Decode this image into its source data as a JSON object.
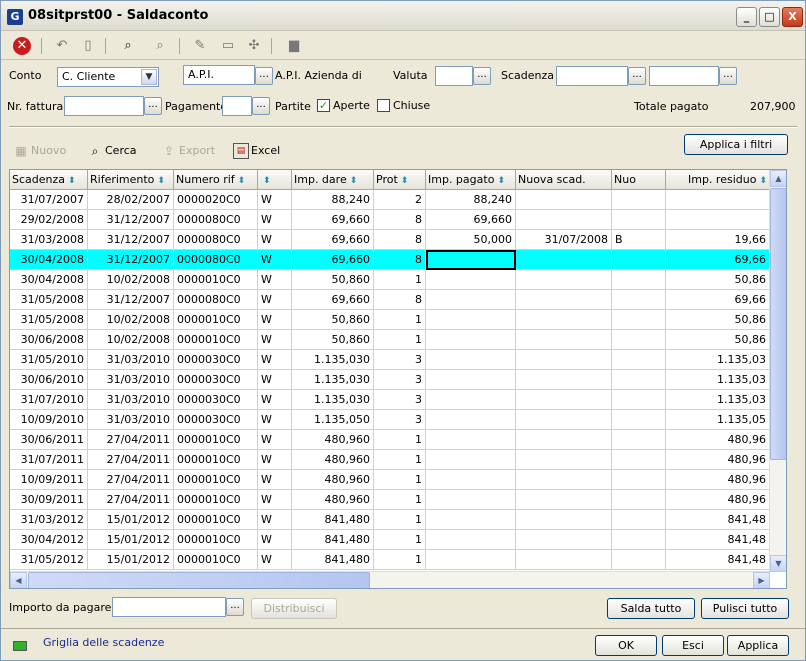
{
  "window": {
    "title": "08sitprst00 - Saldaconto",
    "app_icon": "G",
    "minimize": "_",
    "maximize": "□",
    "close": "X"
  },
  "filters": {
    "conto_label": "Conto",
    "conto_value": "C. Cliente",
    "code_value": "A.P.I.",
    "code_desc": "A.P.I. Azienda di",
    "valuta_label": "Valuta",
    "scadenza_label": "Scadenza",
    "nr_fattura_label": "Nr. fattura",
    "pagamento_label": "Pagamento",
    "partite_label": "Partite",
    "aperte_label": "Aperte",
    "chiuse_label": "Chiuse",
    "totale_label": "Totale pagato",
    "totale_value": "207,900",
    "dots_label": "..."
  },
  "actions": {
    "nuovo": "Nuovo",
    "cerca": "Cerca",
    "export": "Export",
    "excel": "Excel",
    "applica_filtri": "Applica i filtri"
  },
  "grid": {
    "headers": [
      "Scadenza",
      "Riferimento",
      "Numero rif",
      "",
      "Imp. dare",
      "Prot",
      "Imp. pagato",
      "Nuova scad.",
      "Nuo",
      "Imp. residuo"
    ],
    "rows": [
      [
        "31/07/2007",
        "28/02/2007",
        "0000020C0",
        "W",
        "88,240",
        "2",
        "88,240",
        "",
        "",
        ""
      ],
      [
        "29/02/2008",
        "31/12/2007",
        "0000080C0",
        "W",
        "69,660",
        "8",
        "69,660",
        "",
        "",
        ""
      ],
      [
        "31/03/2008",
        "31/12/2007",
        "0000080C0",
        "W",
        "69,660",
        "8",
        "50,000",
        "31/07/2008",
        "B",
        "19,66"
      ],
      [
        "30/04/2008",
        "31/12/2007",
        "0000080C0",
        "W",
        "69,660",
        "8",
        "",
        "",
        "",
        "69,66"
      ],
      [
        "30/04/2008",
        "10/02/2008",
        "0000010C0",
        "W",
        "50,860",
        "1",
        "",
        "",
        "",
        "50,86"
      ],
      [
        "31/05/2008",
        "31/12/2007",
        "0000080C0",
        "W",
        "69,660",
        "8",
        "",
        "",
        "",
        "69,66"
      ],
      [
        "31/05/2008",
        "10/02/2008",
        "0000010C0",
        "W",
        "50,860",
        "1",
        "",
        "",
        "",
        "50,86"
      ],
      [
        "30/06/2008",
        "10/02/2008",
        "0000010C0",
        "W",
        "50,860",
        "1",
        "",
        "",
        "",
        "50,86"
      ],
      [
        "31/05/2010",
        "31/03/2010",
        "0000030C0",
        "W",
        "1.135,030",
        "3",
        "",
        "",
        "",
        "1.135,03"
      ],
      [
        "30/06/2010",
        "31/03/2010",
        "0000030C0",
        "W",
        "1.135,030",
        "3",
        "",
        "",
        "",
        "1.135,03"
      ],
      [
        "31/07/2010",
        "31/03/2010",
        "0000030C0",
        "W",
        "1.135,030",
        "3",
        "",
        "",
        "",
        "1.135,03"
      ],
      [
        "10/09/2010",
        "31/03/2010",
        "0000030C0",
        "W",
        "1.135,050",
        "3",
        "",
        "",
        "",
        "1.135,05"
      ],
      [
        "30/06/2011",
        "27/04/2011",
        "0000010C0",
        "W",
        "480,960",
        "1",
        "",
        "",
        "",
        "480,96"
      ],
      [
        "31/07/2011",
        "27/04/2011",
        "0000010C0",
        "W",
        "480,960",
        "1",
        "",
        "",
        "",
        "480,96"
      ],
      [
        "10/09/2011",
        "27/04/2011",
        "0000010C0",
        "W",
        "480,960",
        "1",
        "",
        "",
        "",
        "480,96"
      ],
      [
        "30/09/2011",
        "27/04/2011",
        "0000010C0",
        "W",
        "480,960",
        "1",
        "",
        "",
        "",
        "480,96"
      ],
      [
        "31/03/2012",
        "15/01/2012",
        "0000010C0",
        "W",
        "841,480",
        "1",
        "",
        "",
        "",
        "841,48"
      ],
      [
        "30/04/2012",
        "15/01/2012",
        "0000010C0",
        "W",
        "841,480",
        "1",
        "",
        "",
        "",
        "841,48"
      ],
      [
        "31/05/2012",
        "15/01/2012",
        "0000010C0",
        "W",
        "841,480",
        "1",
        "",
        "",
        "",
        "841,48"
      ]
    ],
    "selected_row": 3
  },
  "bottom": {
    "importo_label": "Importo da pagare",
    "distribuisci": "Distribuisci",
    "salda_tutto": "Salda tutto",
    "pulisci_tutto": "Pulisci tutto"
  },
  "status": {
    "text": "Griglia delle scadenze",
    "ok": "OK",
    "esci": "Esci",
    "applica": "Applica"
  },
  "colors": {
    "selection": "#00ffff",
    "accent": "#1a3f8f"
  }
}
